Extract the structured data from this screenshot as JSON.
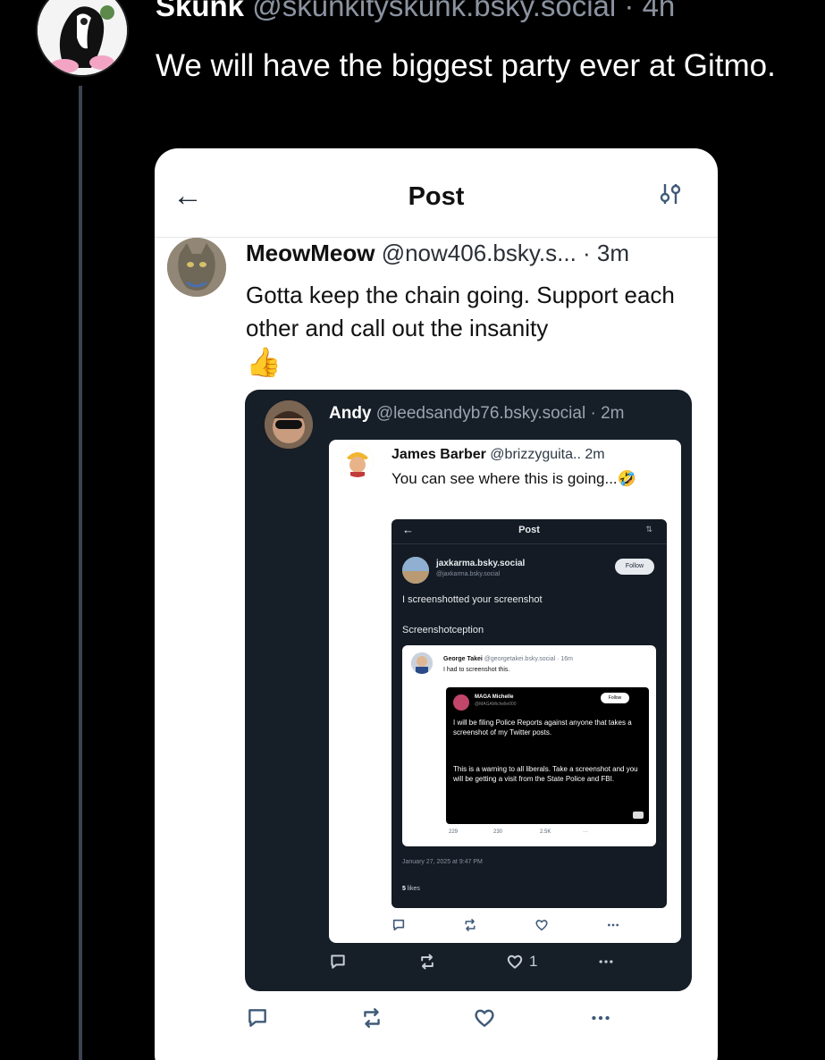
{
  "post": {
    "author_name": "Skunk",
    "handle": "@skunkityskunk.bsky.social",
    "time": "· 4h",
    "text": "We will have the biggest party ever at Gitmo."
  },
  "screenshot1": {
    "back_label": "←",
    "header_title": "Post",
    "author_name": "MeowMeow",
    "handle": "@now406.bsky.s...",
    "time": "· 3m",
    "text": "Gotta keep the chain going. Support each other and call out the insanity",
    "emoji": "👍"
  },
  "screenshot2": {
    "author_name": "Andy",
    "handle": "@leedsandyb76.bsky.social",
    "time": "· 2m",
    "like_count": "1"
  },
  "screenshot3": {
    "author_name": "James Barber",
    "handle": "@brizzyguita..",
    "time": "2m",
    "text": "You can see where this is going...🤣"
  },
  "screenshot4": {
    "back_label": "←",
    "header_title": "Post",
    "sliders_label": "⇅",
    "username": "jaxkarma.bsky.social",
    "handle": "@jaxkarma.bsky.social",
    "follow_label": "Follow",
    "text1": "I screenshotted your screenshot",
    "text2": "Screenshotception",
    "date": "January 27, 2025 at 9:47 PM",
    "likes_count": "5",
    "likes_label": "likes"
  },
  "screenshot5": {
    "author_name": "George Takei",
    "handle": "@georgetakei.bsky.social",
    "time": "· 16m",
    "text": "I had to screenshot this.",
    "replies": "229",
    "reposts": "230",
    "likes": "2.5K",
    "more": "···"
  },
  "screenshot6": {
    "author_name": "MAGA Michelle",
    "handle": "@MAGAMichelle000",
    "follow_label": "Follow",
    "text1": "I will be filing Police Reports against anyone that takes a screenshot of my Twitter posts.",
    "text2": "This is a warning to all liberals. Take a screenshot and you will be getting a visit from the State Police and FBI."
  },
  "colors": {
    "background": "#000000",
    "card_light": "#ffffff",
    "card_dark": "#161e27",
    "thread_line": "#3a4350",
    "handle_gray": "#8b93a0"
  }
}
